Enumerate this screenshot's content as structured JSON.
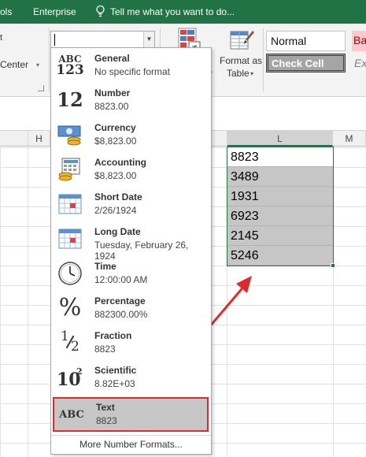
{
  "menubar": {
    "item_left": "ols",
    "enterprise": "Enterprise",
    "tell_me": "Tell me what you want to do..."
  },
  "ribbon": {
    "t_fragment": "t",
    "center_label": "Center",
    "cond_fmt_fragment": "l",
    "format_as_table_line1": "Format as",
    "format_as_table_line2": "Table",
    "styles": {
      "normal": "Normal",
      "bad": "Ba",
      "check_cell": "Check Cell",
      "explanatory": "Ex"
    }
  },
  "columns": {
    "h": "H",
    "l": "L",
    "m": "M"
  },
  "cells": [
    "8823",
    "3489",
    "1931",
    "6923",
    "2145",
    "5246"
  ],
  "format_menu": {
    "items": [
      {
        "name": "General",
        "example": "No specific format",
        "icon": "abc-123-icon"
      },
      {
        "name": "Number",
        "example": "8823.00",
        "icon": "number-12-icon"
      },
      {
        "name": "Currency",
        "example": "$8,823.00",
        "icon": "currency-icon"
      },
      {
        "name": "Accounting",
        "example": " $8,823.00",
        "icon": "accounting-icon"
      },
      {
        "name": "Short Date",
        "example": "2/26/1924",
        "icon": "calendar-icon"
      },
      {
        "name": "Long Date",
        "example": "Tuesday, February 26, 1924",
        "icon": "calendar-icon"
      },
      {
        "name": "Time",
        "example": "12:00:00 AM",
        "icon": "clock-icon"
      },
      {
        "name": "Percentage",
        "example": "882300.00%",
        "icon": "percent-icon"
      },
      {
        "name": "Fraction",
        "example": "8823",
        "icon": "fraction-icon"
      },
      {
        "name": "Scientific",
        "example": "8.82E+03",
        "icon": "scientific-icon"
      },
      {
        "name": "Text",
        "example": "8823",
        "icon": "abc-text-icon"
      }
    ],
    "selected": "Text",
    "more": "More Number Formats..."
  },
  "icon_text": {
    "abc": "ABC",
    "n123": "123",
    "n12": "12",
    "percent": "%",
    "one": "1",
    "two": "2",
    "ten": "10",
    "sup": "2"
  },
  "colors": {
    "excel_green": "#217346",
    "highlight_red": "#e02a2a",
    "selection_gray": "#c6c6c6"
  }
}
